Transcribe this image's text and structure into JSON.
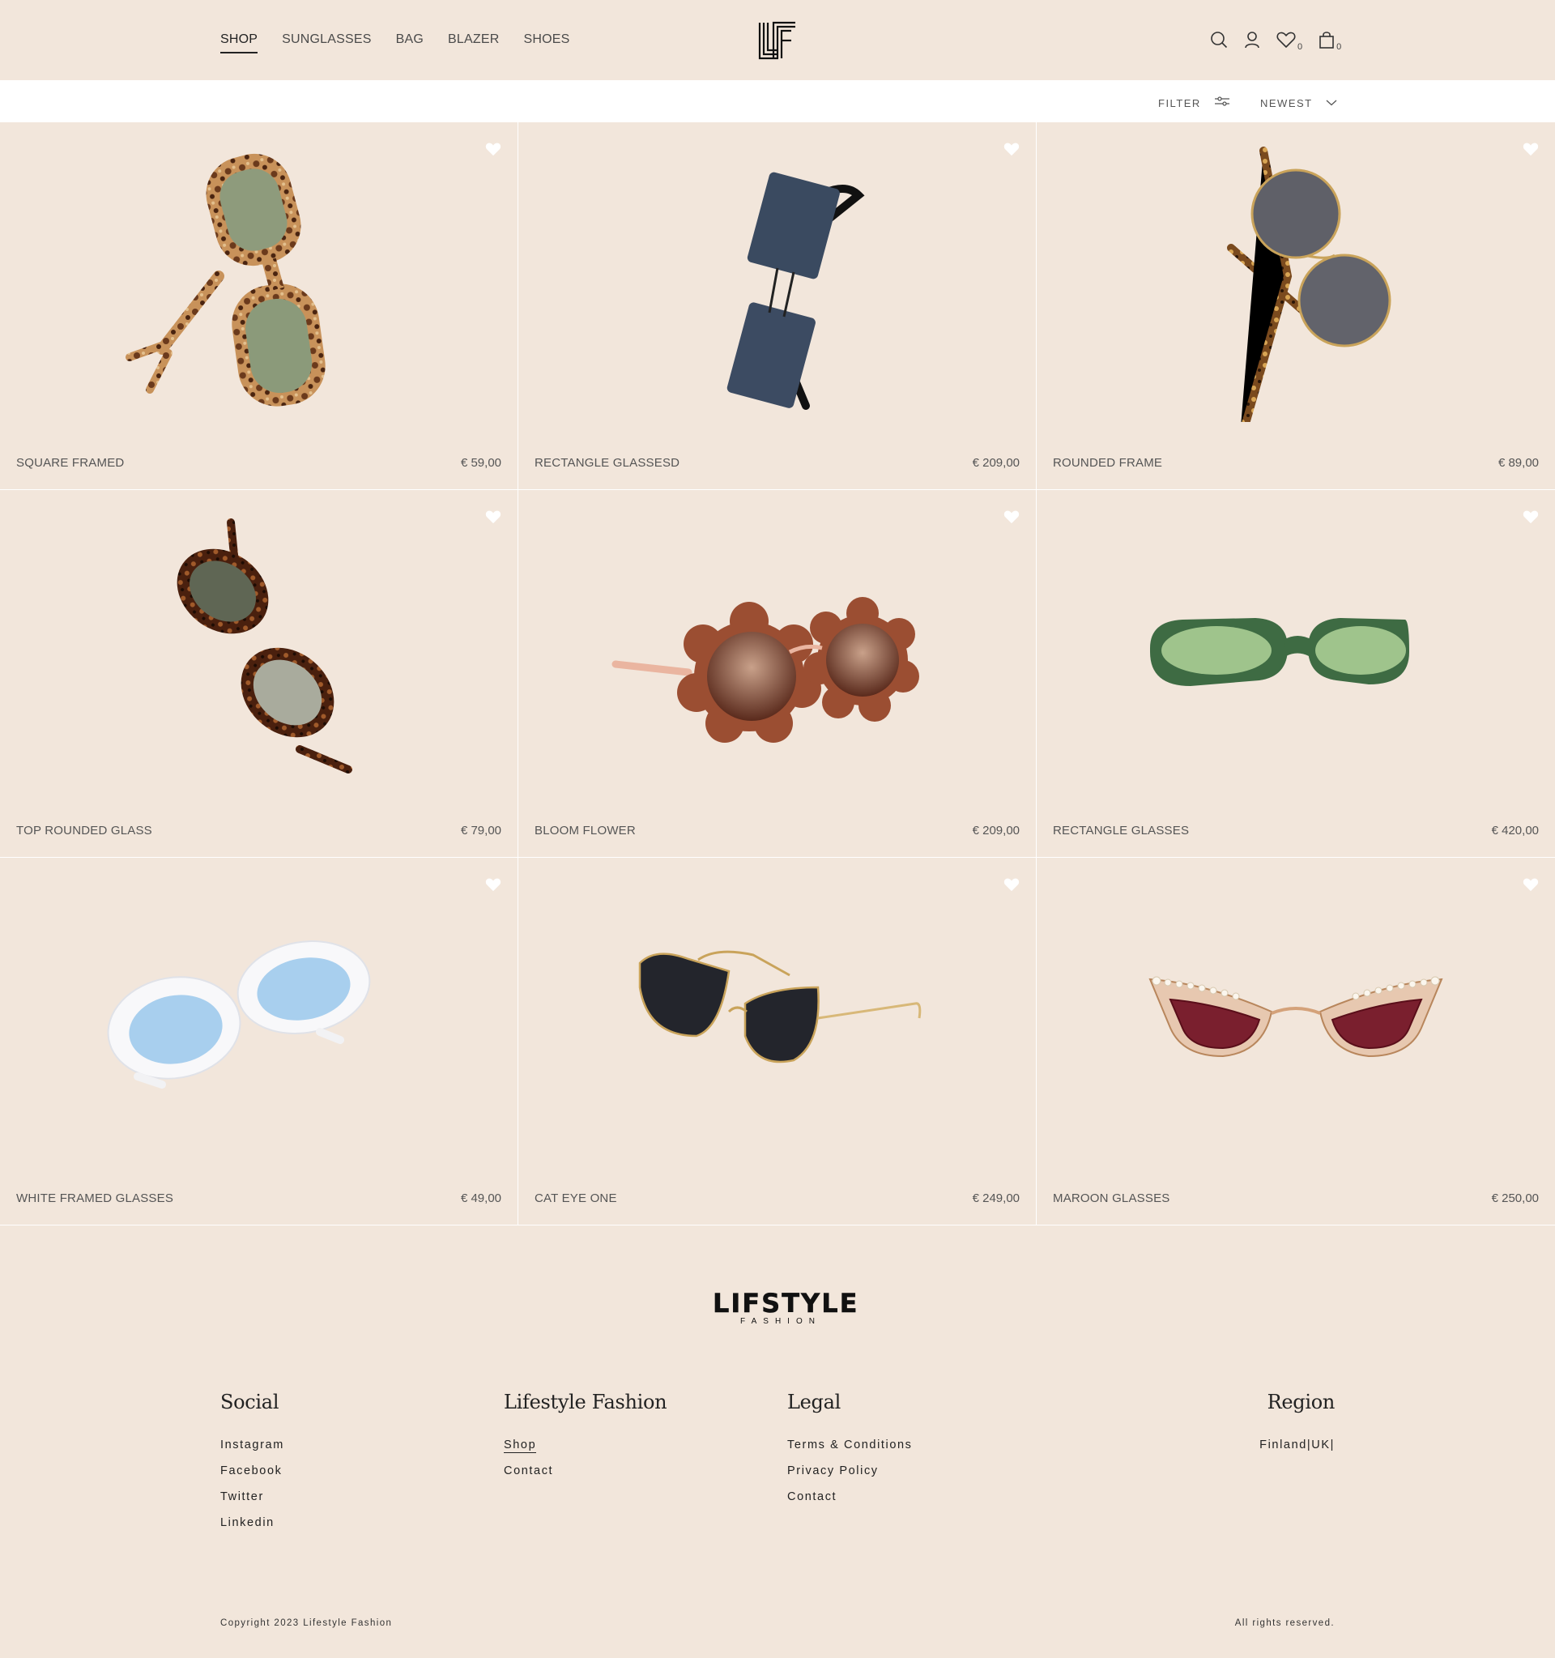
{
  "header": {
    "nav": [
      {
        "label": "SHOP",
        "active": true
      },
      {
        "label": "SUNGLASSES",
        "active": false
      },
      {
        "label": "BAG",
        "active": false
      },
      {
        "label": "BLAZER",
        "active": false
      },
      {
        "label": "SHOES",
        "active": false
      }
    ],
    "logo_icon": "lf-monogram-logo",
    "wishlist_count": "0",
    "cart_count": "0"
  },
  "toolbar": {
    "filter_label": "FILTER",
    "sort_label": "NEWEST"
  },
  "products": [
    {
      "name": "SQUARE FRAMED",
      "price": "€ 59,00",
      "image": "tortoise-rounded-square-sunglasses"
    },
    {
      "name": "RECTANGLE GLASSESD",
      "price": "€ 209,00",
      "image": "navy-rectangle-sunglasses"
    },
    {
      "name": "ROUNDED FRAME",
      "price": "€ 89,00",
      "image": "round-grey-tortoise-sunglasses"
    },
    {
      "name": "TOP ROUNDED GLASS",
      "price": "€ 79,00",
      "image": "dark-tortoise-oval-sunglasses"
    },
    {
      "name": "BLOOM FLOWER",
      "price": "€ 209,00",
      "image": "flower-shaped-brown-sunglasses"
    },
    {
      "name": "RECTANGLE GLASSES",
      "price": "€ 420,00",
      "image": "green-rectangle-sunglasses"
    },
    {
      "name": "WHITE FRAMED GLASSES",
      "price": "€ 49,00",
      "image": "white-oval-blue-lens-sunglasses"
    },
    {
      "name": "CAT EYE ONE",
      "price": "€ 249,00",
      "image": "black-cat-eye-gold-sunglasses"
    },
    {
      "name": "MAROON GLASSES",
      "price": "€ 250,00",
      "image": "maroon-pearl-cat-eye-sunglasses"
    }
  ],
  "footer": {
    "logo_word": "LIFSTYLE",
    "logo_sub": "FASHION",
    "social": {
      "title": "Social",
      "links": [
        "Instagram",
        "Facebook",
        "Twitter",
        "Linkedin"
      ]
    },
    "lifestyle": {
      "title": "Lifestyle Fashion",
      "links": [
        "Shop",
        "Contact"
      ]
    },
    "legal": {
      "title": "Legal",
      "links": [
        "Terms & Conditions",
        "Privacy Policy",
        "Contact"
      ]
    },
    "region": {
      "title": "Region",
      "links": [
        "Finland|UK|"
      ]
    },
    "copyright": "Copyright 2023 Lifestyle Fashion",
    "rights": "All rights reserved."
  },
  "colors": {
    "background": "#f2e6db",
    "toolbar": "#ffffff",
    "text": "#3a3a3a"
  }
}
